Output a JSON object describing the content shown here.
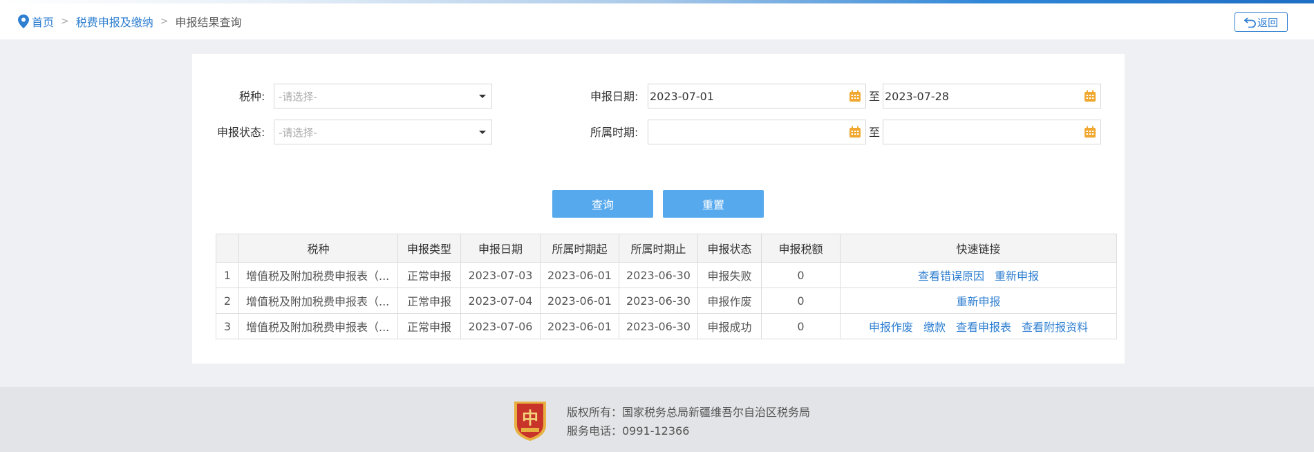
{
  "breadcrumb": {
    "home": "首页",
    "level1": "税费申报及缴纳",
    "current": "申报结果查询",
    "sep": ">"
  },
  "header": {
    "back_label": "返回"
  },
  "form": {
    "tax_type_label": "税种:",
    "tax_type_placeholder": "-请选择-",
    "status_label": "申报状态:",
    "status_placeholder": "-请选择-",
    "filing_date_label": "申报日期:",
    "filing_date_from": "2023-07-01",
    "filing_date_to": "2023-07-28",
    "period_label": "所属时期:",
    "period_from": "",
    "period_to": "",
    "to_text": "至"
  },
  "buttons": {
    "query": "查询",
    "reset": "重置"
  },
  "table": {
    "headers": [
      "",
      "税种",
      "申报类型",
      "申报日期",
      "所属时期起",
      "所属时期止",
      "申报状态",
      "申报税额",
      "快速链接"
    ],
    "rows": [
      {
        "index": "1",
        "tax": "增值税及附加税费申报表（...",
        "type": "正常申报",
        "date": "2023-07-03",
        "from": "2023-06-01",
        "to": "2023-06-30",
        "status": "申报失败",
        "amount": "0",
        "links": [
          "查看错误原因",
          "重新申报"
        ]
      },
      {
        "index": "2",
        "tax": "增值税及附加税费申报表（...",
        "type": "正常申报",
        "date": "2023-07-04",
        "from": "2023-06-01",
        "to": "2023-06-30",
        "status": "申报作废",
        "amount": "0",
        "links": [
          "重新申报"
        ]
      },
      {
        "index": "3",
        "tax": "增值税及附加税费申报表（...",
        "type": "正常申报",
        "date": "2023-07-06",
        "from": "2023-06-01",
        "to": "2023-06-30",
        "status": "申报成功",
        "amount": "0",
        "links": [
          "申报作废",
          "缴款",
          "查看申报表",
          "查看附报资料"
        ]
      }
    ]
  },
  "footer": {
    "copyright": "版权所有：国家税务总局新疆维吾尔自治区税务局",
    "phone": "服务电话：0991-12366",
    "emblem_text": "中"
  },
  "colors": {
    "accent": "#2f7fd1",
    "button": "#57a9ee",
    "calendar_icon": "#f0a830",
    "emblem_red": "#c8342a",
    "emblem_gold": "#e8b040"
  },
  "icons": {
    "breadcrumb": "location-pin-icon",
    "back": "undo-arrow-icon",
    "date": "calendar-icon",
    "select": "caret-down-icon",
    "footer": "tax-emblem-icon"
  }
}
